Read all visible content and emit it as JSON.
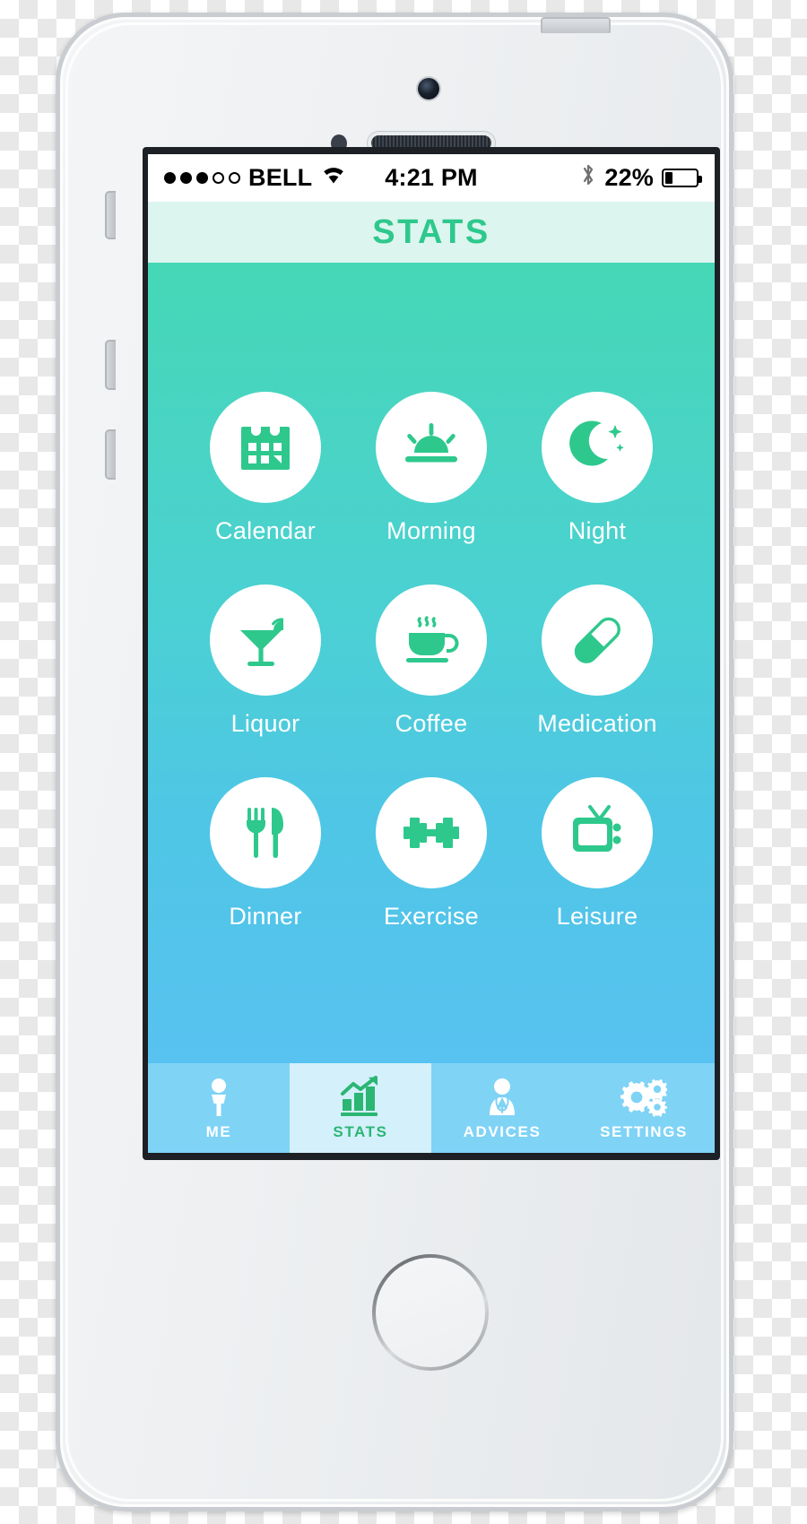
{
  "device": {
    "type": "white-smartphone",
    "body_color": "#eef0f2",
    "bezel_color": "#c9cdd1"
  },
  "status_bar": {
    "signal_dots_filled": 3,
    "signal_dots_total": 5,
    "carrier": "BELL",
    "wifi_icon": "wifi-icon",
    "time": "4:21 PM",
    "bluetooth_icon": "bluetooth-icon",
    "battery_percent": "22%",
    "battery_level": 22,
    "text_color": "#000000"
  },
  "nav_bar": {
    "title": "STATS",
    "title_color": "#2ec88d",
    "background": "#ddf5ef"
  },
  "content": {
    "gradient_top": "#45d7b6",
    "gradient_bottom": "#58c2f0",
    "icon_color": "#2ec88d",
    "circle_color": "#ffffff",
    "label_color": "#ffffff",
    "rows": [
      [
        {
          "label": "Calendar",
          "icon": "calendar-icon"
        },
        {
          "label": "Morning",
          "icon": "sunrise-icon"
        },
        {
          "label": "Night",
          "icon": "moon-stars-icon"
        }
      ],
      [
        {
          "label": "Liquor",
          "icon": "cocktail-glass-icon"
        },
        {
          "label": "Coffee",
          "icon": "coffee-cup-icon"
        },
        {
          "label": "Medication",
          "icon": "pill-capsule-icon"
        }
      ],
      [
        {
          "label": "Dinner",
          "icon": "fork-knife-icon"
        },
        {
          "label": "Exercise",
          "icon": "dumbbell-icon"
        },
        {
          "label": "Leisure",
          "icon": "television-icon"
        }
      ]
    ]
  },
  "tab_bar": {
    "background": "#7fd3f5",
    "active_background": "#d4f0fb",
    "active_color": "#2bb673",
    "inactive_color": "#ffffff",
    "tabs": [
      {
        "label": "ME",
        "icon": "person-icon",
        "active": false
      },
      {
        "label": "STATS",
        "icon": "bar-chart-icon",
        "active": true
      },
      {
        "label": "ADVICES",
        "icon": "doctor-icon",
        "active": false
      },
      {
        "label": "SETTINGS",
        "icon": "gears-icon",
        "active": false
      }
    ]
  }
}
